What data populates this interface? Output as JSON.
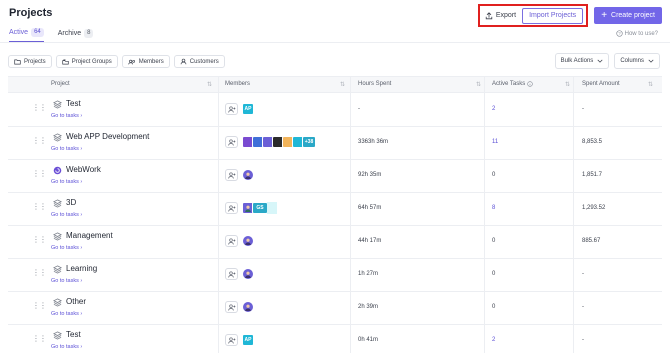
{
  "page": {
    "title": "Projects"
  },
  "actions": {
    "export_label": "Export",
    "import_label": "Import Projects",
    "create_label": "Create project"
  },
  "tabs": [
    {
      "label": "Active",
      "count": "64"
    },
    {
      "label": "Archive",
      "count": "8"
    }
  ],
  "help": {
    "label": "How to use?"
  },
  "filters": [
    "Projects",
    "Project Groups",
    "Members",
    "Customers"
  ],
  "dropdowns": {
    "bulk_actions": "Bulk Actions",
    "columns": "Columns"
  },
  "columns": {
    "project": "Project",
    "members": "Members",
    "hours": "Hours Spent",
    "tasks": "Active Tasks",
    "spent": "Spent Amount"
  },
  "goto_label": "Go to tasks",
  "rows": [
    {
      "name": "Test",
      "hours": "-",
      "tasks": "2",
      "spent": "-",
      "icon": "stack-icon"
    },
    {
      "name": "Web APP Development",
      "hours": "3363h 36m",
      "tasks": "11",
      "spent": "8,853.5",
      "icon": "stack-icon"
    },
    {
      "name": "WebWork",
      "hours": "92h 35m",
      "tasks": "0",
      "spent": "1,851.7",
      "icon": "webwork-logo-icon"
    },
    {
      "name": "3D",
      "hours": "64h 57m",
      "tasks": "8",
      "spent": "1,293.52",
      "icon": "stack-icon"
    },
    {
      "name": "Management",
      "hours": "44h 17m",
      "tasks": "0",
      "spent": "885.67",
      "icon": "stack-icon"
    },
    {
      "name": "Learning",
      "hours": "1h 27m",
      "tasks": "0",
      "spent": "-",
      "icon": "stack-icon"
    },
    {
      "name": "Other",
      "hours": "2h 39m",
      "tasks": "0",
      "spent": "-",
      "icon": "stack-icon"
    },
    {
      "name": "Test",
      "hours": "0h 41m",
      "tasks": "2",
      "spent": "-",
      "icon": "stack-icon"
    }
  ],
  "avatar_labels": {
    "ap": "AP",
    "gs": "GS",
    "more": "+38"
  },
  "colors": {
    "accent": "#7266e8",
    "link": "#5b4fd6",
    "highlight": "#e0201f",
    "avatar_teal": "#1fb7d6"
  }
}
